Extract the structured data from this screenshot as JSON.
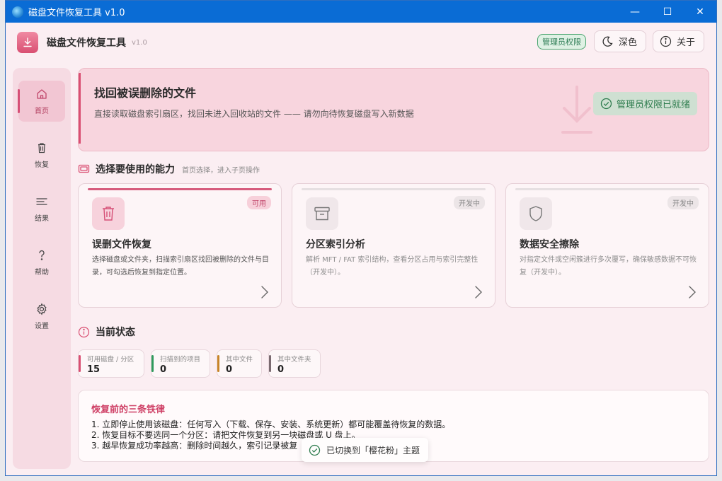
{
  "window": {
    "title": "磁盘文件恢复工具 v1.0",
    "controls": {
      "minimize": "—",
      "maximize": "☐",
      "close": "✕"
    }
  },
  "header": {
    "app_name": "磁盘文件恢复工具",
    "version": "v1.0",
    "admin_badge": "管理员权限",
    "theme_button": "深色",
    "about_button": "关于"
  },
  "sidebar": {
    "items": [
      {
        "label": "首页",
        "icon": "home-icon",
        "active": true
      },
      {
        "label": "恢复",
        "icon": "trash-icon",
        "active": false
      },
      {
        "label": "结果",
        "icon": "list-icon",
        "active": false
      },
      {
        "label": "帮助",
        "icon": "help-icon",
        "active": false
      },
      {
        "label": "设置",
        "icon": "gear-icon",
        "active": false
      }
    ]
  },
  "hero": {
    "title": "找回被误删除的文件",
    "description": "直接读取磁盘索引扇区，找回未进入回收站的文件 —— 请勿向待恢复磁盘写入新数据",
    "status": "管理员权限已就绪"
  },
  "capabilities": {
    "title": "选择要使用的能力",
    "subtitle": "首页选择，进入子页操作",
    "cards": [
      {
        "title": "误删文件恢复",
        "tag": "可用",
        "description": "选择磁盘或文件夹，扫描索引扇区找回被删除的文件与目录，可勾选后恢复到指定位置。",
        "icon": "trash-icon",
        "available": true
      },
      {
        "title": "分区索引分析",
        "tag": "开发中",
        "description": "解析 MFT / FAT 索引结构，查看分区占用与索引完整性（开发中）。",
        "icon": "archive-icon",
        "available": false
      },
      {
        "title": "数据安全擦除",
        "tag": "开发中",
        "description": "对指定文件或空闲簇进行多次覆写，确保敏感数据不可恢复（开发中）。",
        "icon": "shield-icon",
        "available": false
      }
    ]
  },
  "status": {
    "title": "当前状态",
    "stats": [
      {
        "label": "可用磁盘 / 分区",
        "value": "15",
        "color": "#d94f72"
      },
      {
        "label": "扫描到的项目",
        "value": "0",
        "color": "#2f9a5c"
      },
      {
        "label": "其中文件",
        "value": "0",
        "color": "#c88428"
      },
      {
        "label": "其中文件夹",
        "value": "0",
        "color": "#7a6a70"
      }
    ]
  },
  "rules": {
    "title": "恢复前的三条铁律",
    "items": [
      "1. 立即停止使用该磁盘：任何写入（下载、保存、安装、系统更新）都可能覆盖待恢复的数据。",
      "2. 恢复目标不要选同一个分区：请把文件恢复到另一块磁盘或 U 盘上。",
      "3. 越早恢复成功率越高：删除时间越久，索引记录被复"
    ]
  },
  "toast": {
    "message": "已切换到「樱花粉」主题"
  },
  "colors": {
    "accent": "#d94f72",
    "titlebar": "#0a6cd5",
    "success": "#2f7d4f"
  }
}
